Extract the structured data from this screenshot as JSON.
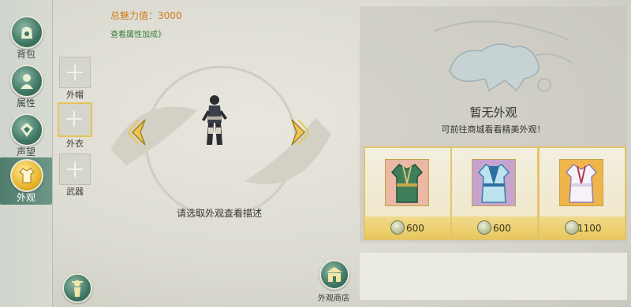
{
  "nav": {
    "items": [
      {
        "label": "背包",
        "icon": "bag-icon"
      },
      {
        "label": "属性",
        "icon": "attributes-icon"
      },
      {
        "label": "声望",
        "icon": "reputation-icon"
      },
      {
        "label": "外观",
        "icon": "appearance-icon",
        "active": true
      }
    ]
  },
  "charm": {
    "label": "总魅力值：3000"
  },
  "attr_link": "查看属性加成》",
  "slots": [
    {
      "label": "外帽"
    },
    {
      "label": "外衣",
      "selected": true
    },
    {
      "label": "武器"
    }
  ],
  "preview": {
    "hint": "请选取外观查看描述"
  },
  "shop": {
    "label": "外观商店"
  },
  "right": {
    "empty_title": "暂无外观",
    "empty_subtitle": "可前往商城看看精美外观！",
    "items": [
      {
        "price": "600",
        "color": "#3f7e5a"
      },
      {
        "price": "600",
        "color": "#5aa0c8"
      },
      {
        "price": "1100",
        "color": "#d8cfe8"
      }
    ]
  },
  "colors": {
    "accent_gold": "#e3c46b",
    "charm_orange": "#d07a1e",
    "link_green": "#3a7d3a",
    "nav_green": "#3f7764"
  }
}
